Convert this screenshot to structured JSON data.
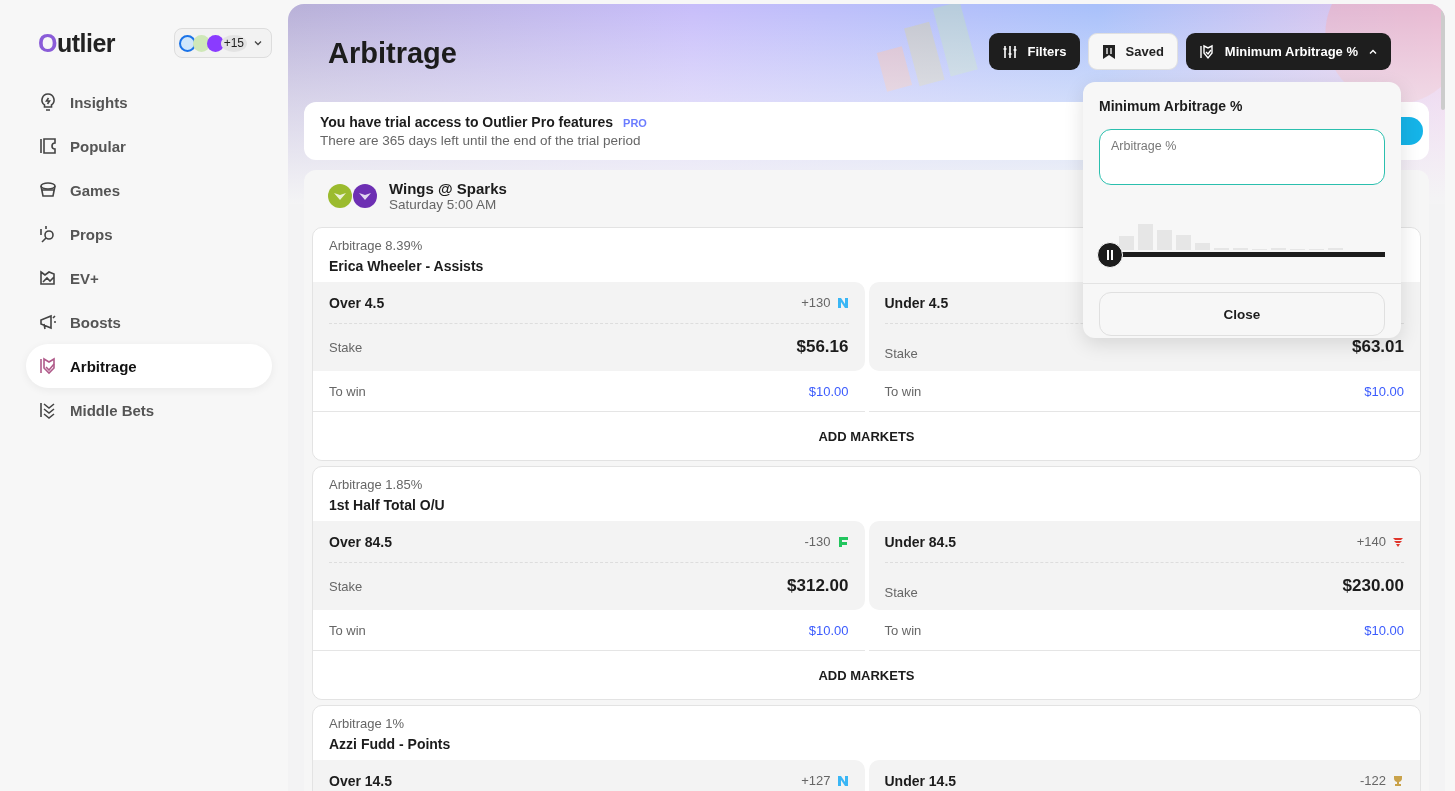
{
  "sidebar": {
    "logo": "Outlier",
    "books_more": "+15",
    "items": [
      {
        "label": "Insights",
        "selected": false
      },
      {
        "label": "Popular",
        "selected": false
      },
      {
        "label": "Games",
        "selected": false
      },
      {
        "label": "Props",
        "selected": false
      },
      {
        "label": "EV+",
        "selected": false
      },
      {
        "label": "Boosts",
        "selected": false
      },
      {
        "label": "Arbitrage",
        "selected": true
      },
      {
        "label": "Middle Bets",
        "selected": false
      }
    ]
  },
  "header": {
    "title": "Arbitrage",
    "buttons": [
      {
        "label": "Filters",
        "kind": "dark"
      },
      {
        "label": "Saved",
        "kind": "light"
      },
      {
        "label": "Minimum Arbitrage %",
        "kind": "dropdown",
        "expanded": true
      }
    ]
  },
  "trial": {
    "title": "You have trial access to Outlier Pro features",
    "badge": "PRO",
    "subtitle": "There are 365 days left until the end of the trial period"
  },
  "game": {
    "teams": [
      {
        "color": "#9bbb2e"
      },
      {
        "color": "#6d2fb3"
      }
    ],
    "title": "Wings @ Sparks",
    "time": "Saturday 5:00 AM"
  },
  "cards": [
    {
      "arbitrage": "Arbitrage 8.39%",
      "market": "Erica Wheeler - Assists",
      "sides": [
        {
          "label": "Over 4.5",
          "odds": "+130",
          "book": {
            "kind": "n",
            "color": "#3ab6f5"
          },
          "stake_label": "Stake",
          "stake": "$56.16",
          "win_label": "To win",
          "win": "$10.00"
        },
        {
          "label": "Under 4.5",
          "stake_label": "Stake",
          "stake": "$63.01",
          "win_label": "To win",
          "win": "$10.00"
        }
      ],
      "action": "ADD MARKETS"
    },
    {
      "arbitrage": "Arbitrage 1.85%",
      "market": "1st Half Total O/U",
      "sides": [
        {
          "label": "Over 84.5",
          "odds": "-130",
          "book": {
            "kind": "f",
            "color": "#22c55e"
          },
          "stake_label": "Stake",
          "stake": "$312.00",
          "win_label": "To win",
          "win": "$10.00"
        },
        {
          "label": "Under 84.5",
          "odds": "+140",
          "book": {
            "kind": "flag",
            "color": "#e0352b"
          },
          "stake_label": "Stake",
          "stake": "$230.00",
          "win_label": "To win",
          "win": "$10.00"
        }
      ],
      "action": "ADD MARKETS"
    },
    {
      "arbitrage": "Arbitrage 1%",
      "market": "Azzi Fudd - Points",
      "sides": [
        {
          "label": "Over 14.5",
          "odds": "+127",
          "book": {
            "kind": "n",
            "color": "#3ab6f5"
          }
        },
        {
          "label": "Under 14.5",
          "odds": "-122",
          "book": {
            "kind": "trophy",
            "color": "#c9a24a"
          }
        }
      ]
    }
  ],
  "popover": {
    "title": "Minimum Arbitrage %",
    "placeholder": "Arbitrage %",
    "slider": {
      "level": 0
    },
    "close": "Close"
  }
}
